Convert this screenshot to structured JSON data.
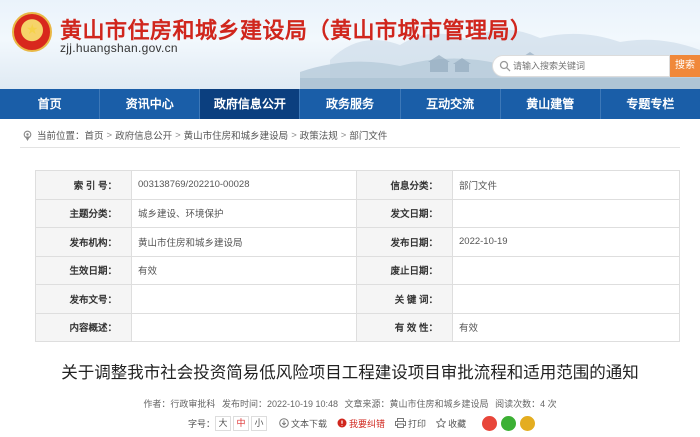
{
  "header": {
    "site_title": "黄山市住房和城乡建设局（黄山市城市管理局）",
    "site_url": "zjj.huangshan.gov.cn",
    "search_placeholder": "请输入搜索关键词",
    "search_button": "搜索"
  },
  "nav": {
    "items": [
      {
        "label": "首页"
      },
      {
        "label": "资讯中心"
      },
      {
        "label": "政府信息公开"
      },
      {
        "label": "政务服务"
      },
      {
        "label": "互动交流"
      },
      {
        "label": "黄山建管"
      },
      {
        "label": "专题专栏"
      }
    ],
    "active_index": 2
  },
  "breadcrumb": {
    "prefix": "当前位置：",
    "items": [
      "首页",
      "政府信息公开",
      "黄山市住房和城乡建设局",
      "政策法规",
      "部门文件"
    ]
  },
  "info": {
    "index_no_label": "索 引 号：",
    "index_no": "003138769/202210-00028",
    "category_label": "信息分类：",
    "category": "部门文件",
    "topic_label": "主题分类：",
    "topic": "城乡建设、环境保护",
    "issue_date_label": "发文日期：",
    "issue_date": "",
    "publisher_label": "发布机构：",
    "publisher": "黄山市住房和城乡建设局",
    "publish_date_label": "发布日期：",
    "publish_date": "2022-10-19",
    "effective_date_label": "生效日期：",
    "effective_date": "有效",
    "repeal_date_label": "废止日期：",
    "repeal_date": "",
    "doc_no_label": "发布文号：",
    "doc_no": "",
    "keywords_label": "关 键 词：",
    "keywords": "",
    "summary_label": "内容概述：",
    "summary": "",
    "validity_label": "有 效 性：",
    "validity": "有效"
  },
  "document": {
    "title": "关于调整我市社会投资简易低风险项目工程建设项目审批流程和适用范围的通知"
  },
  "meta": {
    "author": "作者：行政审批科",
    "time": "发布时间：2022-10-19 10:48",
    "source": "文章来源：黄山市住房和城乡建设局",
    "reads": "阅读次数：4 次"
  },
  "tools": {
    "font_label": "字号：",
    "font_small": "大",
    "font_mid": "中",
    "font_large": "小",
    "download": "文本下载",
    "error": "我要纠错",
    "print": "打印",
    "favorite": "收藏"
  },
  "colors": {
    "nav_bg": "#1a5ea8",
    "nav_active": "#0b3f7f",
    "title_red": "#d0261d",
    "search_button": "#f0883a"
  }
}
